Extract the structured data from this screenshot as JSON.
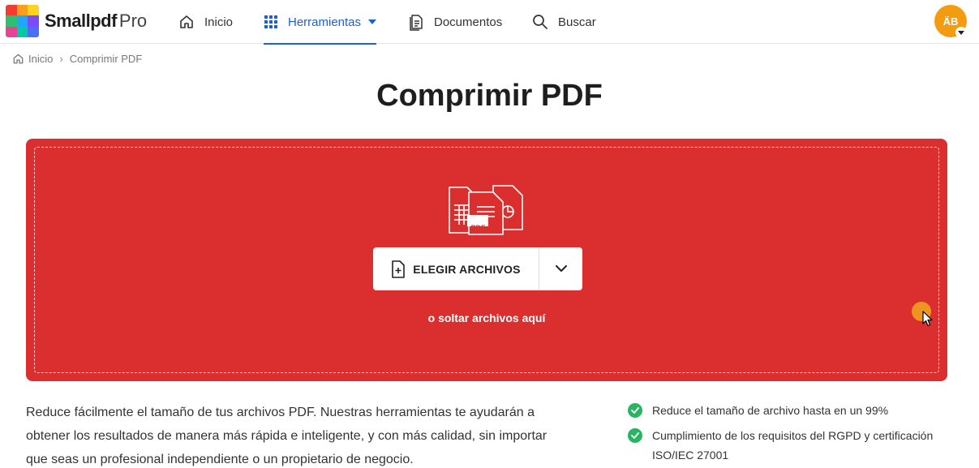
{
  "brand": {
    "name": "Smallpdf",
    "tier": "Pro",
    "logo_colors": [
      "#f33b2f",
      "#ff9c1a",
      "#ffd21f",
      "#2fbf71",
      "#1ea7fd",
      "#7a4cf6",
      "#e84393",
      "#00c9a7",
      "#4c6ef5"
    ]
  },
  "nav": {
    "home_label": "Inicio",
    "tools_label": "Herramientas",
    "documents_label": "Documentos",
    "search_label": "Buscar",
    "active_color": "#1d5fd6"
  },
  "user": {
    "initials": "ÄB",
    "avatar_color": "#f39c12"
  },
  "breadcrumb": {
    "home": "Inicio",
    "current": "Comprimir PDF"
  },
  "page": {
    "title": "Comprimir PDF"
  },
  "dropzone": {
    "color": "#db2f2f",
    "choose_label": "ELEGIR ARCHIVOS",
    "pdf_badge": "PDF",
    "hint": "o soltar archivos aquí"
  },
  "description": "Reduce fácilmente el tamaño de tus archivos PDF. Nuestras herramientas te ayudarán a obtener los resultados de manera más rápida e inteligente, y con más calidad, sin importar que seas un profesional independiente o un propietario de negocio.",
  "features": [
    {
      "text": "Reduce el tamaño de archivo hasta en un 99%"
    },
    {
      "text": "Cumplimiento de los requisitos del RGPD y certificación ISO/IEC 27001"
    }
  ]
}
